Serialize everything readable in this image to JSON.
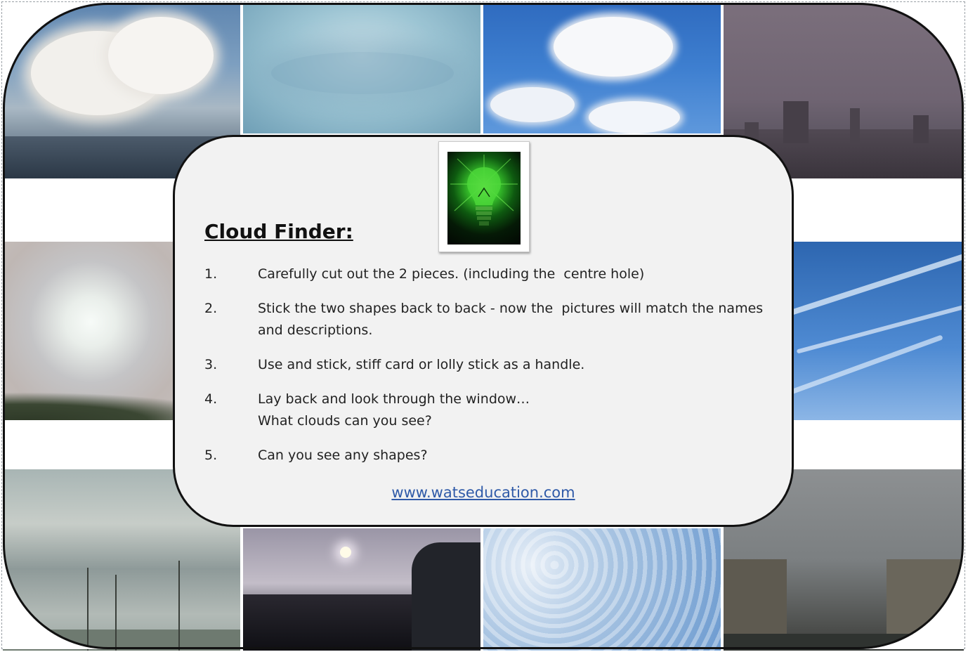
{
  "title": "Cloud Finder:",
  "steps": [
    {
      "num": "1.",
      "text": "Carefully cut out the 2 pieces. (including the  centre hole)"
    },
    {
      "num": "2.",
      "text": "Stick the two shapes back to back - now the  pictures will match the names and descriptions."
    },
    {
      "num": "3.",
      "text": "Use and stick, stiff card or lolly stick as a handle."
    },
    {
      "num": "4.",
      "text": "Lay back and look through the window…\nWhat clouds can you see?"
    },
    {
      "num": "5.",
      "text": "Can you see any shapes?"
    }
  ],
  "link": "www.watseducation.com",
  "icon": "lightbulb-icon",
  "colors": {
    "panel": "#f2f2f2",
    "frame": "#111111",
    "link": "#2f5aa8",
    "bulb_glow": "#37c22b"
  }
}
